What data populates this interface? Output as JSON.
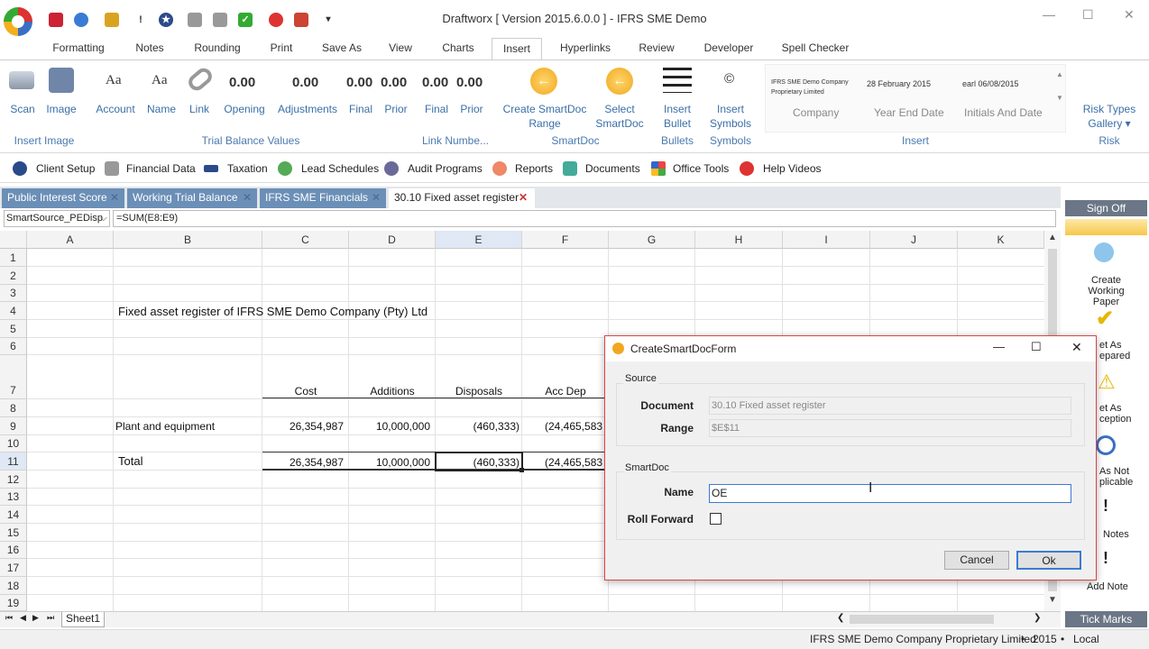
{
  "window": {
    "title": "Draftworx [ Version 2015.6.0.0 ] - IFRS SME Demo"
  },
  "menu_tabs": [
    "Formatting",
    "Notes",
    "Rounding",
    "Print",
    "Save As",
    "View",
    "Charts",
    "Insert",
    "Hyperlinks",
    "Review",
    "Developer",
    "Spell Checker"
  ],
  "active_tab": "Insert",
  "ribbon": {
    "scan": "Scan",
    "image": "Image",
    "account": "Account",
    "name": "Name",
    "link": "Link",
    "opening": "Opening",
    "adjustments": "Adjustments",
    "final": "Final",
    "prior": "Prior",
    "aa": "Aa",
    "num": "0.00",
    "link_final": "Final",
    "link_prior": "Prior",
    "create_smartdoc_range": "Create SmartDoc",
    "create_smartdoc_range2": "Range",
    "select_smartdoc": "Select",
    "select_smartdoc2": "SmartDoc",
    "insert_bullet": "Insert",
    "insert_bullet2": "Bullet",
    "insert_symbols": "Insert",
    "insert_symbols2": "Symbols",
    "copyright": "©",
    "company_small": "IFRS SME Demo Company Proprietary Limited",
    "date_small": "28 February 2015",
    "initials_small": "earl 06/08/2015",
    "company": "Company",
    "year_end": "Year End Date",
    "initials": "Initials And Date",
    "risk_types": "Risk Types",
    "gallery": "Gallery ▾",
    "groups": {
      "insert_image": "Insert Image",
      "trial_balance": "Trial Balance Values",
      "link_numbers": "Link Numbe...",
      "smartdoc": "SmartDoc",
      "bullets": "Bullets",
      "symbols": "Symbols",
      "insert": "Insert",
      "risk": "Risk"
    }
  },
  "quickbar": [
    "Client Setup",
    "Financial Data",
    "Taxation",
    "Lead Schedules",
    "Audit Programs",
    "Reports",
    "Documents",
    "Office Tools",
    "Help Videos"
  ],
  "doc_tabs": [
    "Public Interest Score",
    "Working Trial Balance",
    "IFRS SME Financials",
    "30.10 Fixed asset register"
  ],
  "formula": {
    "namebox": "SmartSource_PEDisp",
    "value": "=SUM(E8:E9)"
  },
  "columns": [
    "A",
    "B",
    "C",
    "D",
    "E",
    "F",
    "G",
    "H",
    "I",
    "J",
    "K"
  ],
  "rows": [
    "1",
    "2",
    "3",
    "4",
    "5",
    "6",
    "7",
    "8",
    "9",
    "10",
    "11",
    "12",
    "13",
    "14",
    "15",
    "16",
    "17",
    "18",
    "19"
  ],
  "sheet": {
    "title": "Fixed asset register of IFRS SME Demo Company (Pty) Ltd",
    "headers": [
      "Cost",
      "Additions",
      "Disposals",
      "Acc Dep"
    ],
    "row9": {
      "label": "Plant and equipment",
      "cost": "26,354,987",
      "additions": "10,000,000",
      "disposals": "(460,333)",
      "accdep": "(24,465,583"
    },
    "row11": {
      "label": "Total",
      "cost": "26,354,987",
      "additions": "10,000,000",
      "disposals": "(460,333)",
      "accdep": "(24,465,583"
    },
    "tab": "Sheet1"
  },
  "right_panel": {
    "sign_off": "Sign Off",
    "create_wp": "Create",
    "create_wp2": "Working",
    "create_wp3": "Paper",
    "set_prepared": "et As",
    "set_prepared2": "epared",
    "set_exception": "et As",
    "set_exception2": "ception",
    "not_applicable": "As Not",
    "not_applicable2": "plicable",
    "notes": "Notes",
    "add_note": "Add Note",
    "tick_marks": "Tick Marks"
  },
  "dialog": {
    "title": "CreateSmartDocForm",
    "source": "Source",
    "document_label": "Document",
    "document_value": "30.10 Fixed asset register",
    "range_label": "Range",
    "range_value": "$E$11",
    "smartdoc": "SmartDoc",
    "name_label": "Name",
    "name_value": "OE",
    "roll_forward": "Roll Forward",
    "cancel": "Cancel",
    "ok": "Ok"
  },
  "status": {
    "company": "IFRS SME Demo Company Proprietary Limited",
    "year": "2015",
    "mode": "Local",
    "sep": "•"
  }
}
